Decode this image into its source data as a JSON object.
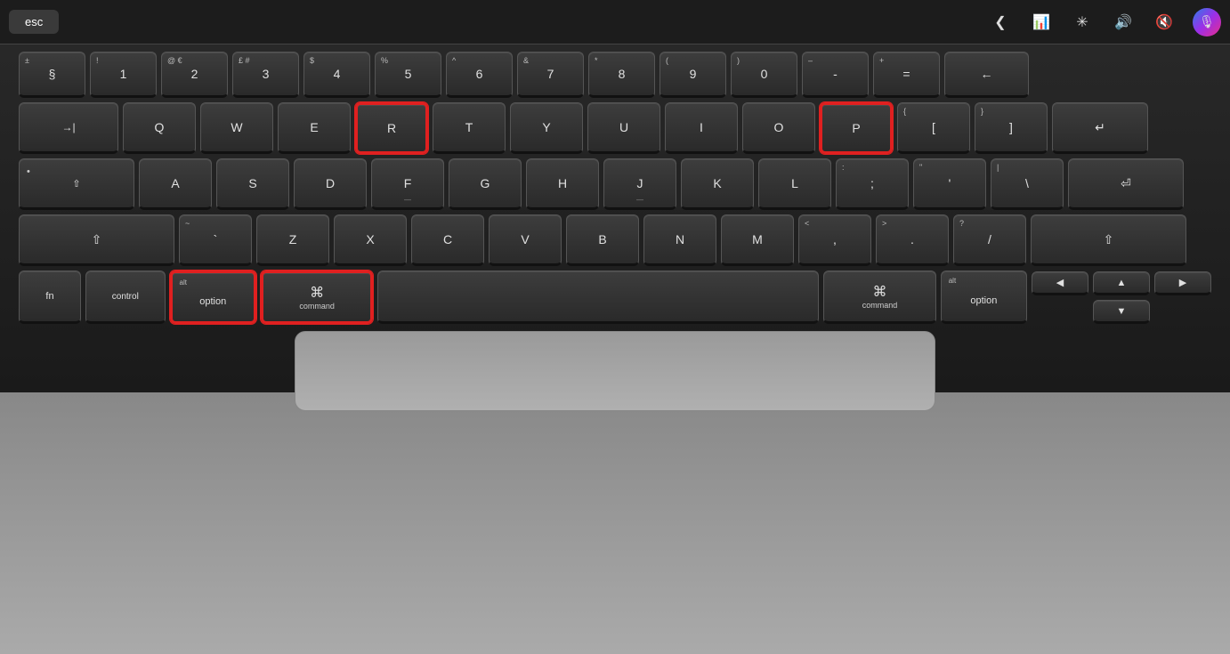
{
  "keyboard": {
    "touchbar": {
      "esc_label": "esc",
      "icons": [
        "chevron",
        "waveform",
        "sun",
        "volume",
        "mute",
        "siri"
      ]
    },
    "row1": {
      "keys": [
        {
          "top": "±",
          "bottom": "§",
          "highlighted": false
        },
        {
          "top": "!",
          "bottom": "1",
          "highlighted": false
        },
        {
          "top": "@€",
          "bottom": "2",
          "highlighted": false
        },
        {
          "top": "£ #",
          "bottom": "3",
          "highlighted": false
        },
        {
          "top": "$",
          "bottom": "4",
          "highlighted": false
        },
        {
          "top": "%",
          "bottom": "5",
          "highlighted": false
        },
        {
          "top": "^",
          "bottom": "6",
          "highlighted": false
        },
        {
          "top": "&",
          "bottom": "7",
          "highlighted": false
        },
        {
          "top": "*",
          "bottom": "8",
          "highlighted": false
        },
        {
          "top": "(",
          "bottom": "9",
          "highlighted": false
        },
        {
          "top": ")",
          "bottom": "0",
          "highlighted": false
        },
        {
          "top": "–",
          "bottom": "-",
          "highlighted": false
        },
        {
          "top": "+",
          "bottom": "=",
          "highlighted": false
        },
        {
          "label": "←",
          "highlighted": false
        }
      ]
    },
    "row2": {
      "tab_label": "→|",
      "keys": [
        {
          "label": "Q",
          "highlighted": false
        },
        {
          "label": "W",
          "highlighted": false
        },
        {
          "label": "E",
          "highlighted": false
        },
        {
          "label": "R",
          "highlighted": true
        },
        {
          "label": "T",
          "highlighted": false
        },
        {
          "label": "Y",
          "highlighted": false
        },
        {
          "label": "U",
          "highlighted": false
        },
        {
          "label": "I",
          "highlighted": false
        },
        {
          "label": "O",
          "highlighted": false
        },
        {
          "label": "P",
          "highlighted": true
        },
        {
          "top": "{",
          "bottom": "[",
          "highlighted": false
        },
        {
          "top": "}",
          "bottom": "]",
          "highlighted": false
        },
        {
          "label": "↵",
          "highlighted": false
        }
      ]
    },
    "row3": {
      "caps_label": "⇧",
      "keys": [
        {
          "label": "A",
          "highlighted": false
        },
        {
          "label": "S",
          "highlighted": false
        },
        {
          "label": "D",
          "highlighted": false
        },
        {
          "label": "F",
          "highlighted": false
        },
        {
          "label": "G",
          "highlighted": false
        },
        {
          "label": "H",
          "highlighted": false
        },
        {
          "label": "J",
          "highlighted": false
        },
        {
          "label": "K",
          "highlighted": false
        },
        {
          "label": "L",
          "highlighted": false
        },
        {
          "top": ":",
          "bottom": ";",
          "highlighted": false
        },
        {
          "top": "\"",
          "bottom": "'",
          "highlighted": false
        },
        {
          "top": "|",
          "bottom": "\\",
          "highlighted": false
        }
      ],
      "return_label": "⏎"
    },
    "row4": {
      "shift_left": "⇧",
      "keys": [
        {
          "label": "~",
          "sub": "`",
          "highlighted": false
        },
        {
          "label": "Z",
          "highlighted": false
        },
        {
          "label": "X",
          "highlighted": false
        },
        {
          "label": "C",
          "highlighted": false
        },
        {
          "label": "V",
          "highlighted": false
        },
        {
          "label": "B",
          "highlighted": false
        },
        {
          "label": "N",
          "highlighted": false
        },
        {
          "label": "M",
          "highlighted": false
        },
        {
          "top": "<",
          "bottom": ",",
          "highlighted": false
        },
        {
          "top": ">",
          "bottom": ".",
          "highlighted": false
        },
        {
          "top": "?",
          "bottom": "/",
          "highlighted": false
        }
      ],
      "shift_right": "⇧"
    },
    "row5": {
      "fn_label": "fn",
      "control_label": "control",
      "option_left": {
        "top_label": "alt",
        "label": "option",
        "highlighted": true
      },
      "command_left": {
        "sym": "⌘",
        "label": "command",
        "highlighted": true
      },
      "space_label": "",
      "command_right": {
        "sym": "⌘",
        "label": "command",
        "highlighted": false
      },
      "option_right": {
        "top_label": "alt",
        "label": "option",
        "highlighted": false
      },
      "arrows": {
        "left": "◀",
        "up": "▲",
        "down": "▼",
        "right": "▶"
      }
    }
  }
}
